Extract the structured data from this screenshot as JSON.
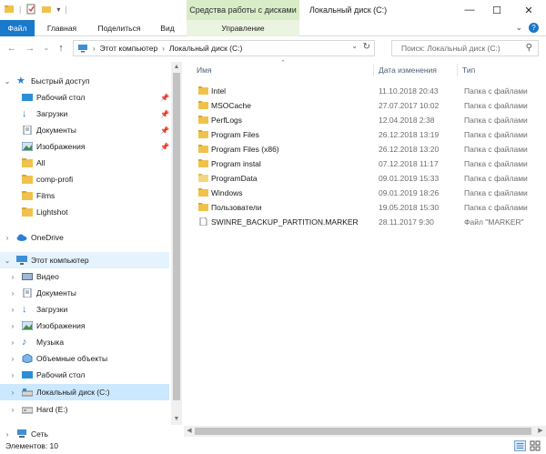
{
  "window": {
    "title": "Локальный диск (C:)",
    "context_group_title": "Средства работы с дисками",
    "accent": "#1979ca",
    "context_color": "#d8ecc8"
  },
  "ribbon": {
    "tabs": [
      {
        "label": "Файл"
      },
      {
        "label": "Главная"
      },
      {
        "label": "Поделиться"
      },
      {
        "label": "Вид"
      },
      {
        "label": "Управление"
      }
    ],
    "help_label": "?"
  },
  "address_bar": {
    "path": [
      "Этот компьютер",
      "Локальный диск (C:)"
    ],
    "search_placeholder": "Поиск: Локальный диск (C:)"
  },
  "nav_pane": {
    "items": [
      {
        "label": "Быстрый доступ",
        "icon": "star-icon",
        "pinned": false
      },
      {
        "label": "Рабочий стол",
        "icon": "desktop-icon",
        "pinned": true
      },
      {
        "label": "Загрузки",
        "icon": "downloads-icon",
        "pinned": true
      },
      {
        "label": "Документы",
        "icon": "documents-icon",
        "pinned": true
      },
      {
        "label": "Изображения",
        "icon": "pictures-icon",
        "pinned": true
      },
      {
        "label": "All",
        "icon": "folder-icon",
        "pinned": false
      },
      {
        "label": "comp-profi",
        "icon": "folder-icon",
        "pinned": false
      },
      {
        "label": "Films",
        "icon": "folder-icon",
        "pinned": false
      },
      {
        "label": "Lightshot",
        "icon": "folder-icon",
        "pinned": false
      },
      {
        "label": "OneDrive",
        "icon": "cloud-icon",
        "pinned": false
      },
      {
        "label": "Этот компьютер",
        "icon": "computer-icon",
        "pinned": false
      },
      {
        "label": "Видео",
        "icon": "video-icon",
        "pinned": false
      },
      {
        "label": "Документы",
        "icon": "documents-icon",
        "pinned": false
      },
      {
        "label": "Загрузки",
        "icon": "downloads-icon",
        "pinned": false
      },
      {
        "label": "Изображения",
        "icon": "pictures-icon",
        "pinned": false
      },
      {
        "label": "Музыка",
        "icon": "music-icon",
        "pinned": false
      },
      {
        "label": "Объемные объекты",
        "icon": "3d-objects-icon",
        "pinned": false
      },
      {
        "label": "Рабочий стол",
        "icon": "desktop-icon",
        "pinned": false
      },
      {
        "label": "Локальный диск (C:)",
        "icon": "drive-icon",
        "pinned": false
      },
      {
        "label": "Hard (E:)",
        "icon": "drive-icon",
        "pinned": false
      },
      {
        "label": "Сеть",
        "icon": "network-icon",
        "pinned": false
      }
    ]
  },
  "file_list": {
    "columns": [
      "Имя",
      "Дата изменения",
      "Тип"
    ],
    "rows": [
      {
        "name": "Intel",
        "date": "11.10.2018 20:43",
        "type": "Папка с файлами",
        "icon": "folder-icon"
      },
      {
        "name": "MSOCache",
        "date": "27.07.2017 10:02",
        "type": "Папка с файлами",
        "icon": "folder-icon"
      },
      {
        "name": "PerfLogs",
        "date": "12.04.2018 2:38",
        "type": "Папка с файлами",
        "icon": "folder-icon"
      },
      {
        "name": "Program Files",
        "date": "26.12.2018 13:19",
        "type": "Папка с файлами",
        "icon": "folder-icon"
      },
      {
        "name": "Program Files (x86)",
        "date": "26.12.2018 13:20",
        "type": "Папка с файлами",
        "icon": "folder-icon"
      },
      {
        "name": "Program instal",
        "date": "07.12.2018 11:17",
        "type": "Папка с файлами",
        "icon": "folder-icon"
      },
      {
        "name": "ProgramData",
        "date": "09.01.2019 15:33",
        "type": "Папка с файлами",
        "icon": "folder-icon"
      },
      {
        "name": "Windows",
        "date": "09.01.2019 18:26",
        "type": "Папка с файлами",
        "icon": "folder-icon"
      },
      {
        "name": "Пользователи",
        "date": "19.05.2018 15:30",
        "type": "Папка с файлами",
        "icon": "folder-icon"
      },
      {
        "name": "SWINRE_BACKUP_PARTITION.MARKER",
        "date": "28.11.2017 9:30",
        "type": "Файл \"MARKER\"",
        "icon": "file-icon"
      }
    ]
  },
  "status_bar": {
    "item_count": "Элементов: 10"
  }
}
